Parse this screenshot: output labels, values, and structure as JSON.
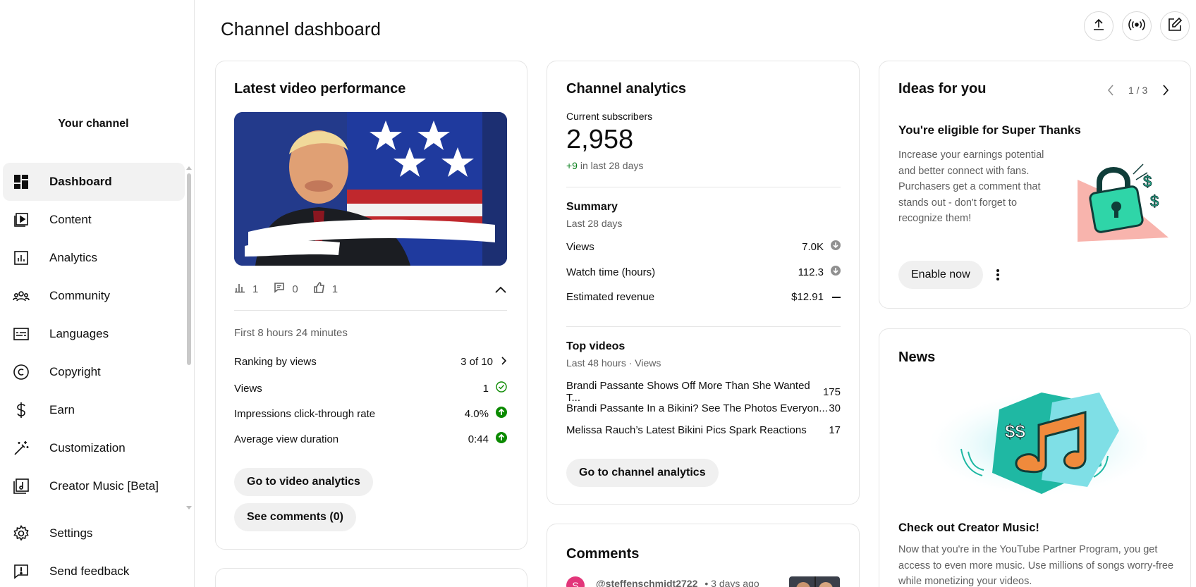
{
  "sidebar": {
    "channel_label": "Your channel",
    "items": [
      {
        "label": "Dashboard",
        "icon": "dashboard-icon"
      },
      {
        "label": "Content",
        "icon": "content-icon"
      },
      {
        "label": "Analytics",
        "icon": "analytics-icon"
      },
      {
        "label": "Community",
        "icon": "community-icon"
      },
      {
        "label": "Languages",
        "icon": "languages-icon"
      },
      {
        "label": "Copyright",
        "icon": "copyright-icon"
      },
      {
        "label": "Earn",
        "icon": "earn-icon"
      },
      {
        "label": "Customization",
        "icon": "customization-icon"
      },
      {
        "label": "Creator Music [Beta]",
        "icon": "music-icon"
      }
    ],
    "bottom_items": [
      {
        "label": "Settings",
        "icon": "gear-icon"
      },
      {
        "label": "Send feedback",
        "icon": "feedback-icon"
      }
    ]
  },
  "header": {
    "title": "Channel dashboard"
  },
  "latest_video": {
    "title": "Latest video performance",
    "stats": {
      "views": "1",
      "comments": "0",
      "likes": "1"
    },
    "period": "First 8 hours 24 minutes",
    "rows": [
      {
        "label": "Ranking by views",
        "value": "3 of 10"
      },
      {
        "label": "Views",
        "value": "1"
      },
      {
        "label": "Impressions click-through rate",
        "value": "4.0%"
      },
      {
        "label": "Average view duration",
        "value": "0:44"
      }
    ],
    "analytics_button": "Go to video analytics",
    "comments_button": "See comments (0)"
  },
  "channel_analytics": {
    "title": "Channel analytics",
    "subs_label": "Current subscribers",
    "subs_value": "2,958",
    "subs_delta": "+9",
    "subs_delta_suffix": " in last 28 days",
    "summary_title": "Summary",
    "summary_period": "Last 28 days",
    "summary_rows": [
      {
        "label": "Views",
        "value": "7.0K"
      },
      {
        "label": "Watch time (hours)",
        "value": "112.3"
      },
      {
        "label": "Estimated revenue",
        "value": "$12.91"
      }
    ],
    "top_title": "Top videos",
    "top_period": "Last 48 hours · Views",
    "top_videos": [
      {
        "title": "Brandi Passante Shows Off More Than She Wanted T...",
        "views": "175"
      },
      {
        "title": "Brandi Passante In a Bikini? See The Photos Everyon...",
        "views": "30"
      },
      {
        "title": "Melissa Rauch’s Latest Bikini Pics Spark Reactions",
        "views": "17"
      }
    ],
    "button": "Go to channel analytics"
  },
  "comments_card": {
    "title": "Comments",
    "first_author": "@steffenschmidt2722",
    "first_time": "• 3 days ago",
    "avatar_letter": "S"
  },
  "ideas": {
    "title": "Ideas for you",
    "pager": "1 / 3",
    "heading": "You're eligible for Super Thanks",
    "body": "Increase your earnings potential and better connect with fans. Purchasers get a comment that stands out - don't forget to recognize them!",
    "button": "Enable now"
  },
  "news": {
    "title": "News",
    "heading": "Check out Creator Music!",
    "body": "Now that you're in the YouTube Partner Program, you get access to even more music. Use millions of songs worry-free while monetizing your videos."
  },
  "colors": {
    "green": "#0b8a00",
    "green_delta": "#0a7f1d",
    "teal": "#1fb8a3",
    "orange": "#f08a3c",
    "avatar_pink": "#e2367a"
  }
}
